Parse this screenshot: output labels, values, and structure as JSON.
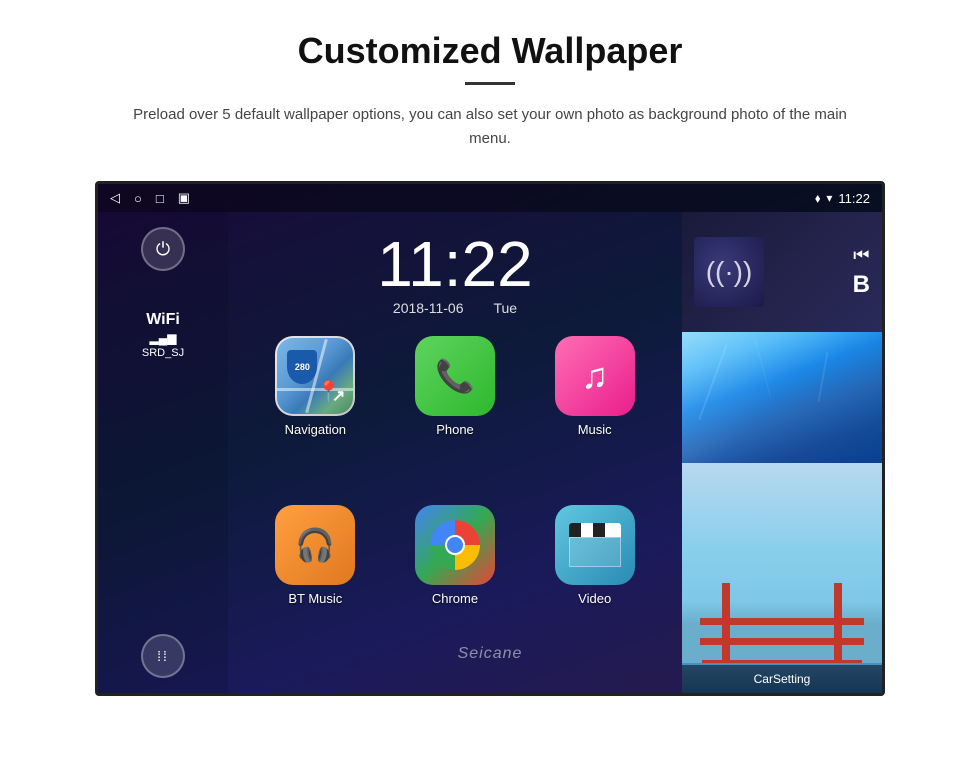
{
  "page": {
    "title": "Customized Wallpaper",
    "description": "Preload over 5 default wallpaper options, you can also set your own photo as background photo of the main menu."
  },
  "statusBar": {
    "time": "11:22",
    "back_icon": "◁",
    "home_icon": "○",
    "recents_icon": "□",
    "screenshot_icon": "▣",
    "location_icon": "⬧",
    "wifi_icon": "▾",
    "time_label": "11:22"
  },
  "sidebar": {
    "power_label": "⏻",
    "wifi_label": "WiFi",
    "wifi_bars": "▂▄▆",
    "wifi_ssid": "SRD_SJ",
    "apps_icon": "⁞⁞"
  },
  "clock": {
    "time": "11:22",
    "date": "2018-11-06",
    "day": "Tue"
  },
  "apps": [
    {
      "id": "navigation",
      "label": "Navigation",
      "type": "nav"
    },
    {
      "id": "phone",
      "label": "Phone",
      "type": "phone"
    },
    {
      "id": "music",
      "label": "Music",
      "type": "music"
    },
    {
      "id": "bt-music",
      "label": "BT Music",
      "type": "bt"
    },
    {
      "id": "chrome",
      "label": "Chrome",
      "type": "chrome"
    },
    {
      "id": "video",
      "label": "Video",
      "type": "video"
    }
  ],
  "media": {
    "prev_icon": "⏮",
    "play_icon": "▶",
    "wifi_icon": "((·))"
  },
  "wallpapers": {
    "top_label": "Ice Wall",
    "bottom_label": "Golden Gate Bridge"
  },
  "carsetting": {
    "label": "CarSetting"
  },
  "watermark": {
    "text": "Seicane"
  }
}
